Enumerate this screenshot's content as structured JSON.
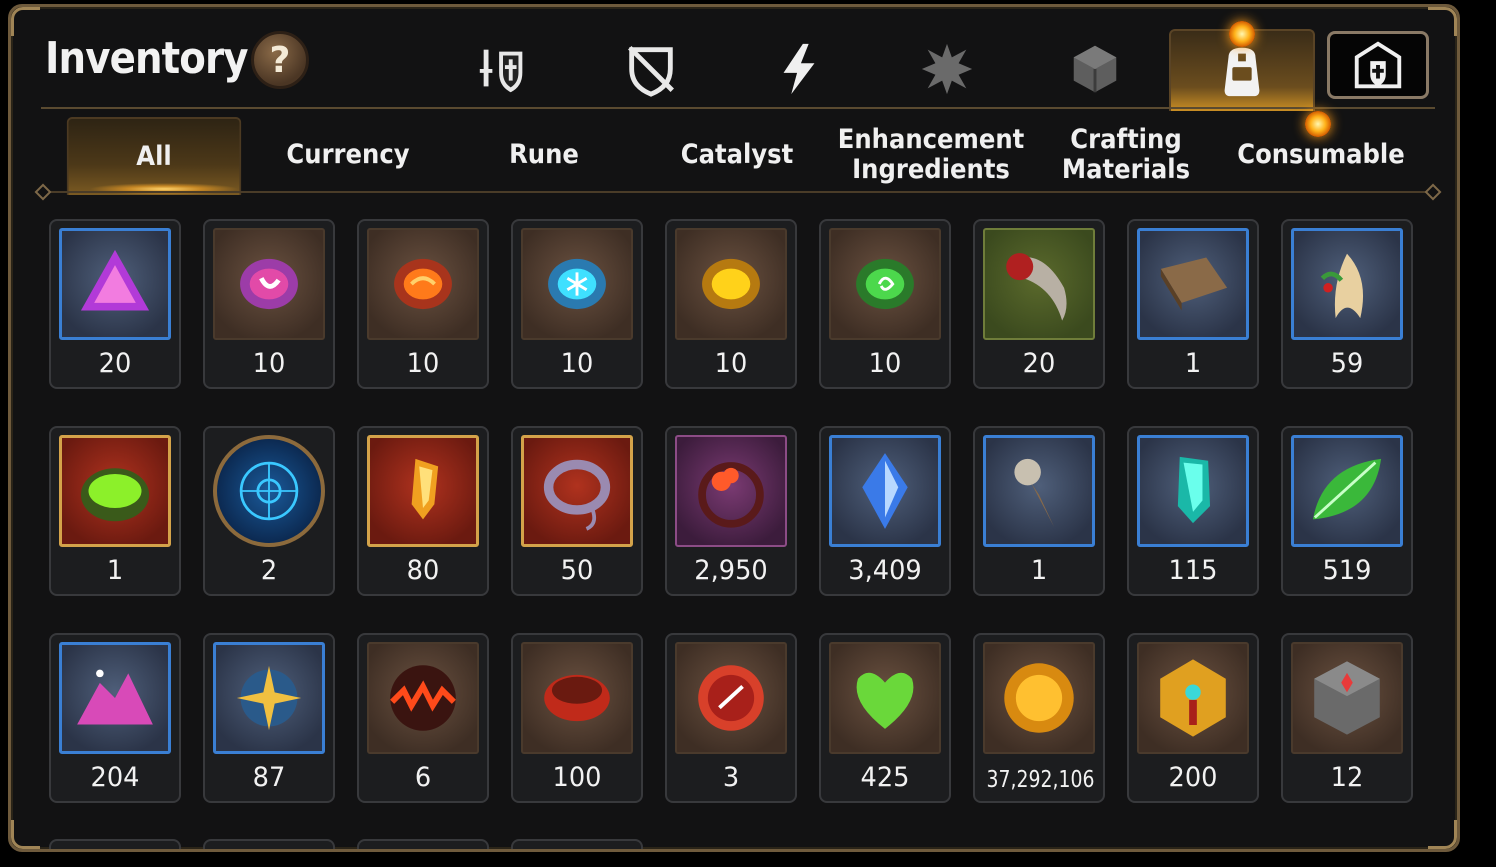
{
  "header": {
    "title": "Inventory",
    "help_label": "?"
  },
  "category_tabs": [
    {
      "icon": "knight-shield-icon",
      "active": false
    },
    {
      "icon": "crossed-shield-icon",
      "active": false
    },
    {
      "icon": "lightning-icon",
      "active": false
    },
    {
      "icon": "spiky-emblem-icon",
      "active": false
    },
    {
      "icon": "cube-icon",
      "active": false
    },
    {
      "icon": "backpack-icon",
      "active": true,
      "notification": true
    },
    {
      "icon": "castle-shield-icon",
      "active": false
    }
  ],
  "sub_tabs": [
    {
      "label": "All",
      "active": true
    },
    {
      "label": "Currency",
      "active": false
    },
    {
      "label": "Rune",
      "active": false
    },
    {
      "label": "Catalyst",
      "active": false
    },
    {
      "label": "Enhancement Ingredients",
      "active": false
    },
    {
      "label": "Crafting Materials",
      "active": false
    },
    {
      "label": "Consumable",
      "active": false,
      "notification": true
    }
  ],
  "items": [
    {
      "icon": "purple-triangle-gem-icon",
      "qty": "20",
      "frame": "blue"
    },
    {
      "icon": "pink-crescent-rune-icon",
      "qty": "10",
      "frame": "brown"
    },
    {
      "icon": "orange-rune-icon",
      "qty": "10",
      "frame": "brown"
    },
    {
      "icon": "cyan-snowflake-rune-icon",
      "qty": "10",
      "frame": "brown"
    },
    {
      "icon": "yellow-rune-icon",
      "qty": "10",
      "frame": "brown"
    },
    {
      "icon": "green-swirl-rune-icon",
      "qty": "10",
      "frame": "brown"
    },
    {
      "icon": "claw-icon",
      "qty": "20",
      "frame": "green"
    },
    {
      "icon": "leather-book-icon",
      "qty": "1",
      "frame": "blue"
    },
    {
      "icon": "ginseng-root-icon",
      "qty": "59",
      "frame": "blue"
    },
    {
      "icon": "green-cauldron-icon",
      "qty": "1",
      "frame": "red"
    },
    {
      "icon": "blue-rune-disc-icon",
      "qty": "2",
      "frame": "round"
    },
    {
      "icon": "golden-crystal-icon",
      "qty": "80",
      "frame": "red"
    },
    {
      "icon": "coiled-rope-icon",
      "qty": "50",
      "frame": "red"
    },
    {
      "icon": "red-flower-ring-icon",
      "qty": "2,950",
      "frame": "purple"
    },
    {
      "icon": "blue-crystal-icon",
      "qty": "3,409",
      "frame": "blue"
    },
    {
      "icon": "pendulum-compass-icon",
      "qty": "1",
      "frame": "blue"
    },
    {
      "icon": "teal-crystal-icon",
      "qty": "115",
      "frame": "blue"
    },
    {
      "icon": "green-leaf-icon",
      "qty": "519",
      "frame": "blue"
    },
    {
      "icon": "pink-gem-pile-icon",
      "qty": "204",
      "frame": "blue"
    },
    {
      "icon": "star-amulet-icon",
      "qty": "87",
      "frame": "blue"
    },
    {
      "icon": "fire-orb-icon",
      "qty": "6",
      "frame": "brown"
    },
    {
      "icon": "red-bracelet-icon",
      "qty": "100",
      "frame": "brown"
    },
    {
      "icon": "red-seal-badge-icon",
      "qty": "3",
      "frame": "brown"
    },
    {
      "icon": "green-heart-icon",
      "qty": "425",
      "frame": "brown"
    },
    {
      "icon": "gold-sun-coin-icon",
      "qty": "37,292,106",
      "frame": "brown"
    },
    {
      "icon": "golden-hexagon-emblem-icon",
      "qty": "200",
      "frame": "brown"
    },
    {
      "icon": "stone-compass-box-icon",
      "qty": "12",
      "frame": "brown"
    }
  ],
  "colors": {
    "accent": "#c98e24",
    "frame": "#6e5a3c",
    "rare_border": "#3a7fd4"
  }
}
